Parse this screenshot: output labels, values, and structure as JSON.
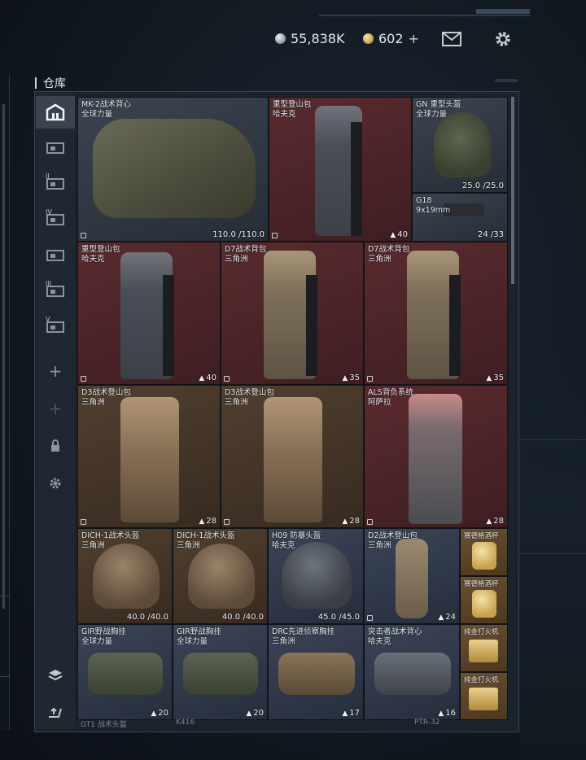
{
  "header": {
    "silver_amount": "55,838K",
    "gold_amount": "602",
    "gold_plus": "+",
    "icons": [
      "silver-coin-icon",
      "gold-coin-icon",
      "mail-icon",
      "gear-icon"
    ]
  },
  "warehouse": {
    "title": "仓库",
    "sidebar_mini_labels": [
      "",
      "II",
      "IV",
      "",
      "III",
      "V",
      "",
      "",
      "",
      ""
    ],
    "items": [
      {
        "name": "MK-2战术背心",
        "sub": "全球力量",
        "stat": "110.0 /110.0",
        "color": "grey"
      },
      {
        "name": "重型登山包",
        "sub": "哈夫克",
        "stat": "40",
        "color": "red"
      },
      {
        "name": "GN 重型头盔",
        "sub": "全球力量",
        "stat": "25.0 /25.0",
        "color": "grey"
      },
      {
        "name": "G18",
        "sub": "9x19mm",
        "stat": "24 /33",
        "color": "grey"
      },
      {
        "name": "重型登山包",
        "sub": "哈夫克",
        "stat": "40",
        "color": "red"
      },
      {
        "name": "D7战术背包",
        "sub": "三角洲",
        "stat": "35",
        "color": "red"
      },
      {
        "name": "D7战术背包",
        "sub": "三角洲",
        "stat": "35",
        "color": "red"
      },
      {
        "name": "D3战术登山包",
        "sub": "三角洲",
        "stat": "28",
        "color": "brown"
      },
      {
        "name": "D3战术登山包",
        "sub": "三角洲",
        "stat": "28",
        "color": "brown"
      },
      {
        "name": "ALS背负系统",
        "sub": "阿萨拉",
        "stat": "28",
        "color": "red"
      },
      {
        "name": "DICH-1战术头盔",
        "sub": "三角洲",
        "stat": "40.0 /40.0",
        "color": "brown"
      },
      {
        "name": "DICH-1战术头盔",
        "sub": "三角洲",
        "stat": "40.0 /40.0",
        "color": "brown"
      },
      {
        "name": "H09 防暴头盔",
        "sub": "哈夫克",
        "stat": "45.0 /45.0",
        "color": "blue"
      },
      {
        "name": "D2战术登山包",
        "sub": "三角洲",
        "stat": "24",
        "color": "blue"
      },
      {
        "name": "赛德格酒杯",
        "sub": "",
        "stat": "",
        "color": "gold"
      },
      {
        "name": "赛德格酒杯",
        "sub": "",
        "stat": "",
        "color": "gold"
      },
      {
        "name": "GIR野战胸挂",
        "sub": "全球力量",
        "stat": "20",
        "color": "blue"
      },
      {
        "name": "GIR野战胸挂",
        "sub": "全球力量",
        "stat": "20",
        "color": "blue"
      },
      {
        "name": "DRC先进侦察胸挂",
        "sub": "三角洲",
        "stat": "17",
        "color": "blue"
      },
      {
        "name": "突击者战术背心",
        "sub": "哈夫克",
        "stat": "16",
        "color": "blue"
      },
      {
        "name": "纯金打火机",
        "sub": "",
        "stat": "",
        "color": "gold"
      },
      {
        "name": "纯金打火机",
        "sub": "",
        "stat": "",
        "color": "gold"
      }
    ],
    "bottom_labels": [
      "GT1 战术头盔",
      "K416",
      "PTR-32"
    ]
  },
  "colors": {
    "grey": "#2f3743",
    "red": "#4c2427",
    "brown": "#45362a",
    "blue": "#2f3848",
    "gold": "#5a4428"
  }
}
